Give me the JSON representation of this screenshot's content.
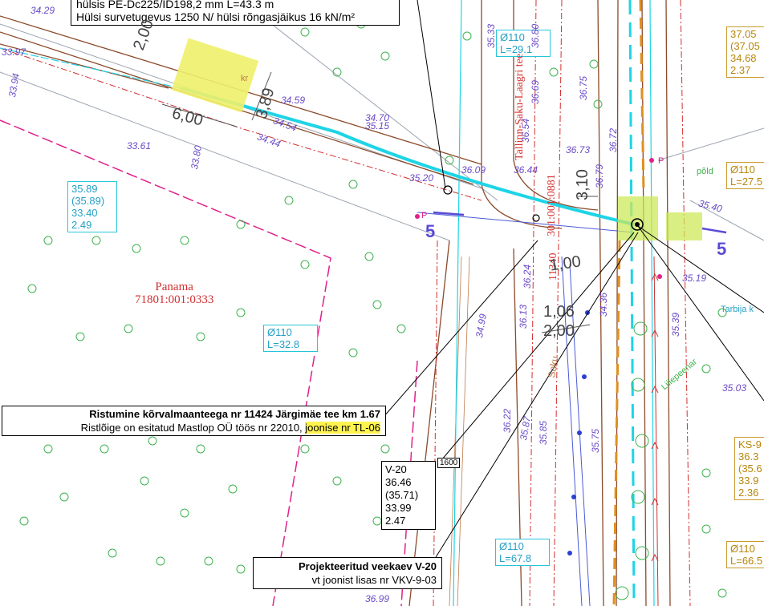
{
  "top_note": {
    "line1": "hülsis PE-Dc225/ID198,2 mm L=43.3 m",
    "line2": "Hülsi survetugevus 1250 N/ hülsi rõngasjäikus 16 kN/m²"
  },
  "crossing_note": {
    "title": "Ristumine kõrvalmaanteega nr 11424 Järgimäe tee km 1.67",
    "text_prefix": "Ristlõige on esitatud Mastlop OÜ töös nr 22010, ",
    "text_highlight": "joonise nr TL-06"
  },
  "well_note": {
    "title": "Projekteeritud veekaev V-20",
    "text": "vt joonist lisas nr VKV-9-03"
  },
  "well_box": {
    "name": "V-20",
    "v1": "36.46",
    "v2": "(35.71)",
    "v3": "33.99",
    "v4": "2.47",
    "tag": "1600"
  },
  "left_box": {
    "v1": "35.89",
    "v2": "(35.89)",
    "v3": "33.40",
    "v4": "2.49"
  },
  "pipes": [
    {
      "d": "Ø110",
      "l": "L=32.8"
    },
    {
      "d": "Ø110",
      "l": "L=29.1"
    },
    {
      "d": "Ø110",
      "l": "L=67.8"
    }
  ],
  "right_orange": {
    "v1": "37.05",
    "v2": "(37.05",
    "v3": "34.68",
    "v4": "2.37"
  },
  "right_ks": {
    "v1": "KS-9",
    "v2": "36.3",
    "v3": "(35.6",
    "v4": "33.9",
    "v5": "2.36"
  },
  "right_pipes": [
    {
      "d": "Ø110",
      "l": "L=27.5"
    },
    {
      "d": "Ø110",
      "l": "L=66.5"
    }
  ],
  "parcel": {
    "name": "Panama",
    "id": "71801:001:0333"
  },
  "road": {
    "name": "Tallinn-Saku-Laagri tee",
    "id": "11340",
    "parcel": "301:001:0881"
  },
  "dims": [
    "2,00",
    "6,00",
    "3,89",
    "3,10",
    "1,00",
    "1,06",
    "2,00"
  ],
  "labels": {
    "kr": "kr",
    "saku": "Saku",
    "pold": "põld",
    "tarbija": "Tarbija k",
    "liliepeen": "Liilepeenar",
    "five": "5",
    "p": "P"
  },
  "elevations": [
    "34.29",
    "33.97",
    "33.94",
    "33.61",
    "33.80",
    "34.59",
    "34.54",
    "34.44",
    "35.15",
    "34.70",
    "35.20",
    "36.80",
    "36.69",
    "36.75",
    "36.72",
    "36.44",
    "36.54",
    "36.09",
    "36.73",
    "36.79",
    "35.40",
    "35.19",
    "35.03",
    "34.99",
    "36.24",
    "36.13",
    "36.22",
    "35.85",
    "35.75",
    "35.87",
    "36.99",
    "35.33",
    "35.39",
    "34.36"
  ]
}
